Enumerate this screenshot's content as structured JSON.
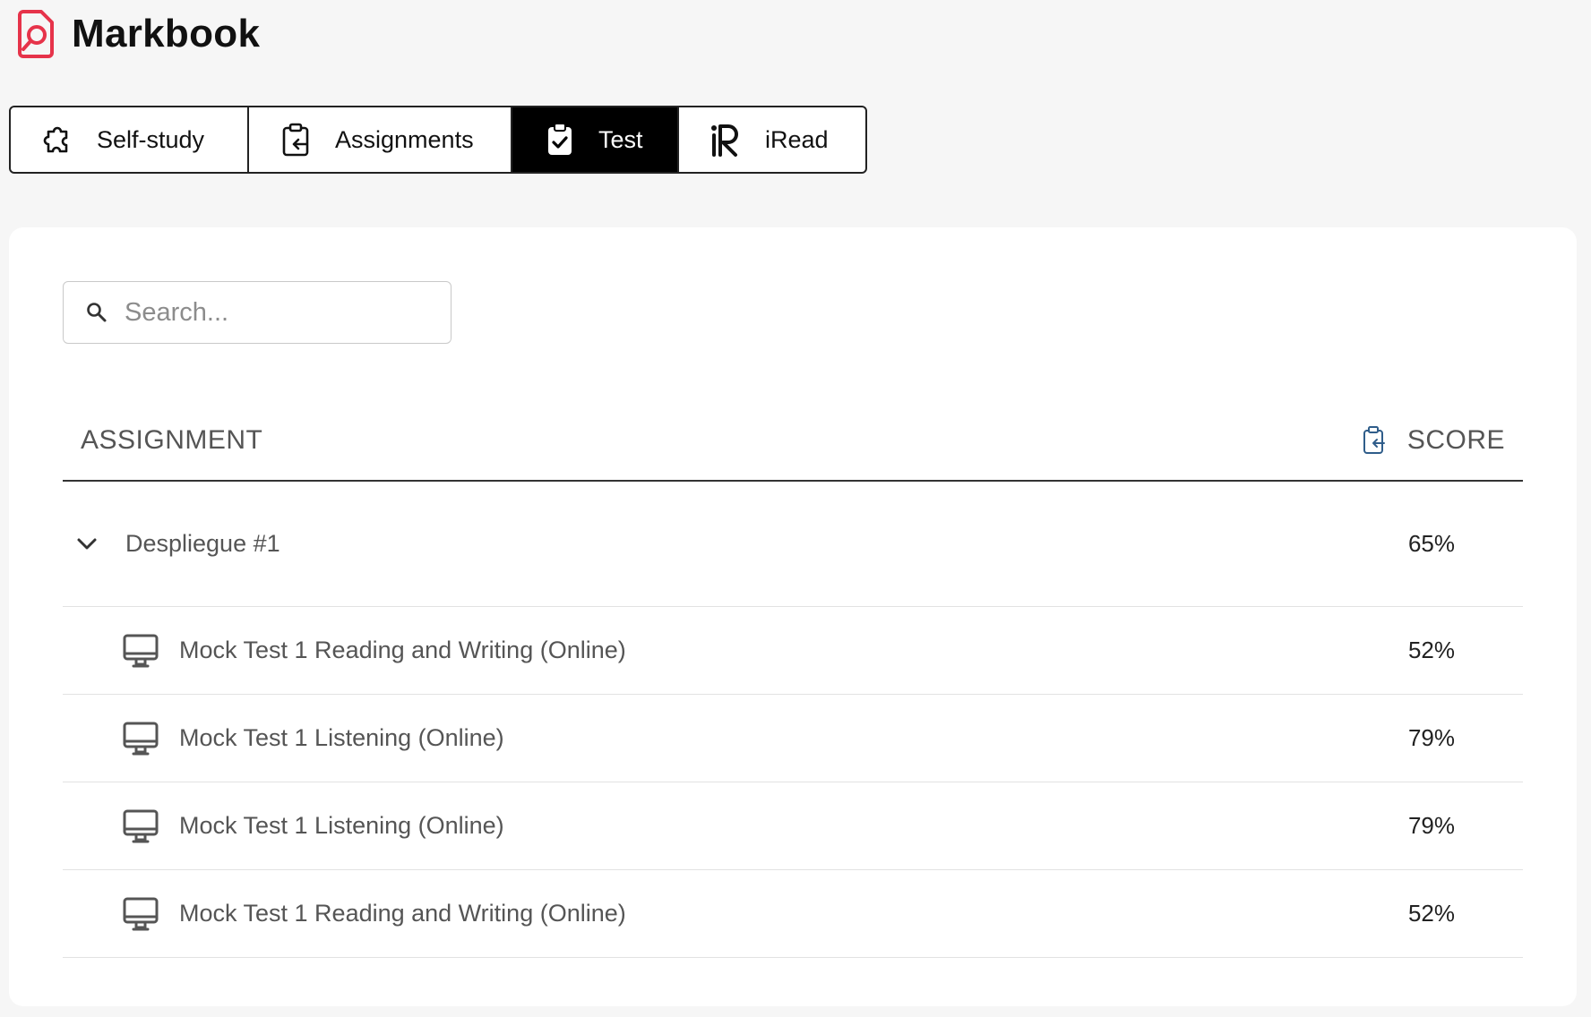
{
  "app": {
    "title": "Markbook",
    "accent": "#e6334a"
  },
  "tabs": [
    {
      "label": "Self-study",
      "icon": "puzzle-icon",
      "active": false
    },
    {
      "label": "Assignments",
      "icon": "clipboard-arrow-icon",
      "active": false
    },
    {
      "label": "Test",
      "icon": "clipboard-check-icon",
      "active": true
    },
    {
      "label": "iRead",
      "icon": "iread-logo-icon",
      "active": false
    }
  ],
  "search": {
    "placeholder": "Search...",
    "value": ""
  },
  "table": {
    "col_assignment": "ASSIGNMENT",
    "col_score": "SCORE",
    "groups": [
      {
        "name": "Despliegue #1",
        "score": "65%",
        "expanded": true,
        "items": [
          {
            "name": "Mock Test 1 Reading and Writing (Online)",
            "score": "52%",
            "icon": "monitor-icon"
          },
          {
            "name": "Mock Test 1 Listening (Online)",
            "score": "79%",
            "icon": "monitor-icon"
          },
          {
            "name": "Mock Test 1 Listening (Online)",
            "score": "79%",
            "icon": "monitor-icon"
          },
          {
            "name": "Mock Test 1 Reading and Writing (Online)",
            "score": "52%",
            "icon": "monitor-icon"
          }
        ]
      }
    ]
  }
}
